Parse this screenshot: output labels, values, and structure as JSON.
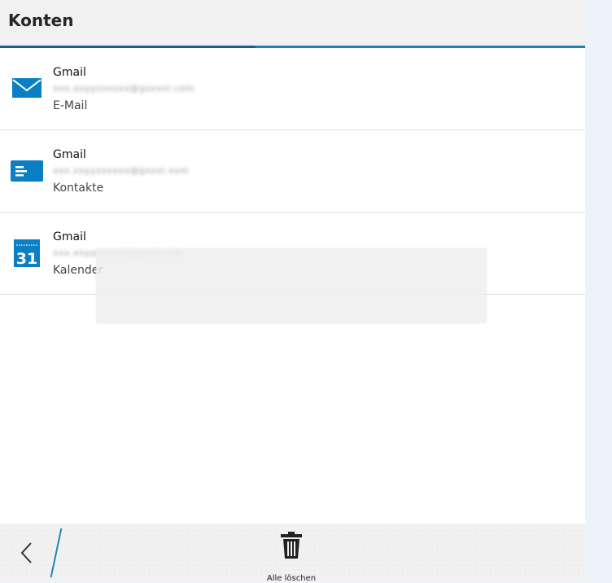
{
  "header": {
    "title": "Konten"
  },
  "accounts": [
    {
      "icon": "mail-icon",
      "name": "Gmail",
      "email": "xxx.xxyyzxxxxx@gxxxxl.com",
      "type": "E-Mail"
    },
    {
      "icon": "contacts-icon",
      "name": "Gmail",
      "email": "xxx.xxyyzxxxxx@gxxxl.xxm",
      "type": "Kontakte"
    },
    {
      "icon": "calendar-icon",
      "name": "Gmail",
      "email": "xxx.xxyyzxxxx@gxxxl.com",
      "type": "Kalender",
      "calendar_day": "31"
    }
  ],
  "bottom_bar": {
    "delete_all_label": "Alle löschen"
  },
  "colors": {
    "accent": "#1e82b4",
    "icon_blue": "#0a7fc4"
  }
}
